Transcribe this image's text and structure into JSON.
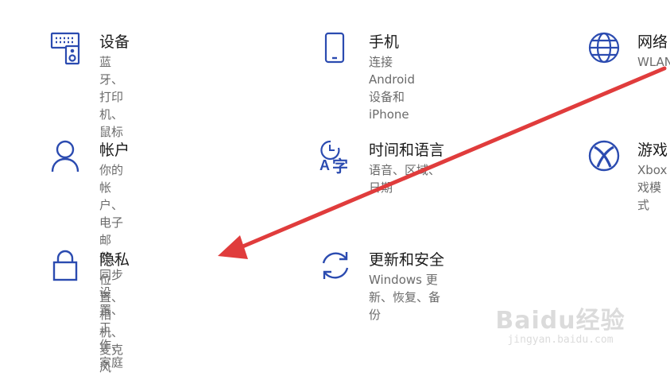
{
  "accent_color": "#2b4bb0",
  "arrow_color": "#e03c3c",
  "tiles": {
    "devices": {
      "title": "设备",
      "desc": "蓝牙、打印机、鼠标",
      "icon": "keyboard-speaker-icon"
    },
    "phone": {
      "title": "手机",
      "desc": "连接 Android 设备和\niPhone",
      "icon": "phone-icon"
    },
    "network": {
      "title": "网络",
      "desc": "WLAN",
      "icon": "globe-icon"
    },
    "accounts": {
      "title": "帐户",
      "desc": "你的帐户、电子邮件、同步\n设置、工作、家庭",
      "icon": "person-icon"
    },
    "time_language": {
      "title": "时间和语言",
      "desc": "语音、区域、日期",
      "icon": "time-language-icon"
    },
    "gaming": {
      "title": "游戏",
      "desc": "Xbox\n戏模式",
      "icon": "xbox-icon"
    },
    "privacy": {
      "title": "隐私",
      "desc": "位置、相机、麦克风",
      "icon": "lock-icon"
    },
    "update_security": {
      "title": "更新和安全",
      "desc": "Windows 更新、恢复、备份",
      "icon": "refresh-icon"
    }
  },
  "watermark": {
    "main": "Baidu经验",
    "sub": "jingyan.baidu.com"
  }
}
